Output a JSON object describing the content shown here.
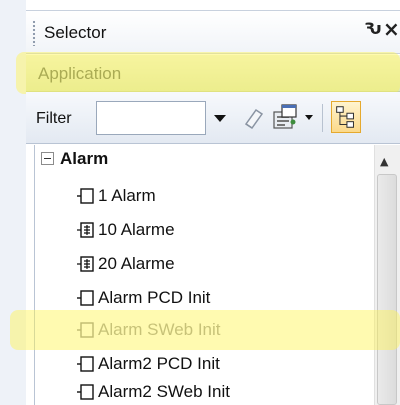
{
  "panel": {
    "title": "Selector",
    "pin_glyph": "Ԅ",
    "close_glyph": "×"
  },
  "application_band": {
    "label": "Application"
  },
  "toolbar": {
    "filter_label": "Filter",
    "filter_value": ""
  },
  "tree": {
    "root": {
      "label": "Alarm",
      "expanded": true
    },
    "items": [
      {
        "label": "1 Alarm",
        "icon": "block-icon"
      },
      {
        "label": "10 Alarme",
        "icon": "multi-block-icon"
      },
      {
        "label": "20 Alarme",
        "icon": "multi-block-icon"
      },
      {
        "label": "Alarm PCD Init",
        "icon": "block-icon"
      },
      {
        "label": "Alarm SWeb Init",
        "icon": "block-icon"
      },
      {
        "label": "Alarm2 PCD Init",
        "icon": "block-icon"
      },
      {
        "label": "Alarm2 SWeb Init",
        "icon": "block-icon"
      }
    ]
  },
  "colors": {
    "highlight": "#fff350",
    "application_band": "#dde8c0",
    "toggle_button": "#fbd98a"
  }
}
